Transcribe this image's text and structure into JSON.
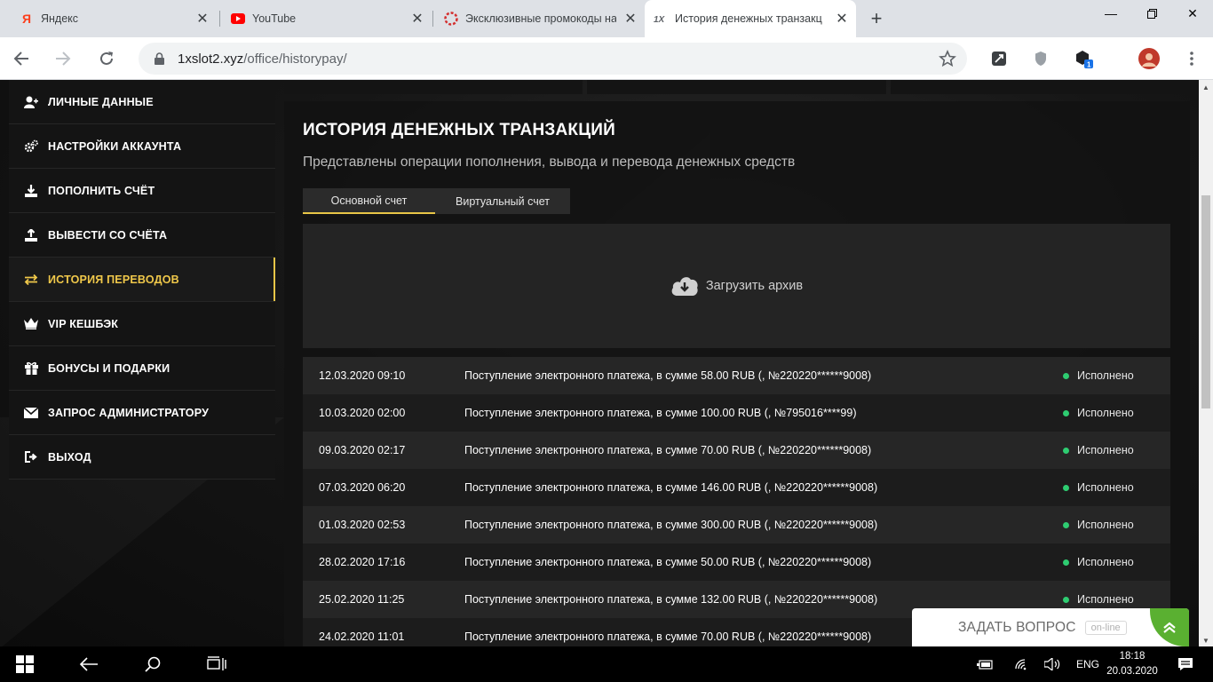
{
  "browser": {
    "tabs": [
      {
        "title": "Яндекс",
        "favicon": "yandex-icon",
        "active": false
      },
      {
        "title": "YouTube",
        "favicon": "youtube-icon",
        "active": false
      },
      {
        "title": "Эксклюзивные промокоды на",
        "favicon": "promo-icon",
        "active": false
      },
      {
        "title": "История денежных транзакц",
        "favicon": "1x-icon",
        "active": true
      }
    ],
    "url_host": "1xslot2.xyz",
    "url_path": "/office/historypay/",
    "extension_badge": "1"
  },
  "sidebar": {
    "items": [
      {
        "label": "ЛИЧНЫЕ ДАННЫЕ",
        "icon": "user-icon",
        "active": false
      },
      {
        "label": "НАСТРОЙКИ АККАУНТА",
        "icon": "gears-icon",
        "active": false
      },
      {
        "label": "ПОПОЛНИТЬ СЧЁТ",
        "icon": "download-icon",
        "active": false
      },
      {
        "label": "ВЫВЕСТИ СО СЧЁТА",
        "icon": "upload-icon",
        "active": false
      },
      {
        "label": "ИСТОРИЯ ПЕРЕВОДОВ",
        "icon": "transfer-arrows-icon",
        "active": true
      },
      {
        "label": "VIP КЕШБЭК",
        "icon": "crown-icon",
        "active": false
      },
      {
        "label": "БОНУСЫ И ПОДАРКИ",
        "icon": "gift-icon",
        "active": false
      },
      {
        "label": "ЗАПРОС АДМИНИСТРАТОРУ",
        "icon": "envelope-icon",
        "active": false
      },
      {
        "label": "ВЫХОД",
        "icon": "exit-icon",
        "active": false
      }
    ]
  },
  "main": {
    "title": "ИСТОРИЯ ДЕНЕЖНЫХ ТРАНЗАКЦИЙ",
    "subtitle": "Представлены операции пополнения, вывода и перевода денежных средств",
    "tabs": [
      {
        "label": "Основной счет",
        "active": true
      },
      {
        "label": "Виртуальный счет",
        "active": false
      }
    ],
    "archive_label": "Загрузить архив",
    "transactions": [
      {
        "date": "12.03.2020 09:10",
        "description": "Поступление электронного платежа, в сумме 58.00 RUB (, №220220******9008)",
        "status": "Исполнено"
      },
      {
        "date": "10.03.2020 02:00",
        "description": "Поступление электронного платежа, в сумме 100.00 RUB (, №795016****99)",
        "status": "Исполнено"
      },
      {
        "date": "09.03.2020 02:17",
        "description": "Поступление электронного платежа, в сумме 70.00 RUB (, №220220******9008)",
        "status": "Исполнено"
      },
      {
        "date": "07.03.2020 06:20",
        "description": "Поступление электронного платежа, в сумме 146.00 RUB (, №220220******9008)",
        "status": "Исполнено"
      },
      {
        "date": "01.03.2020 02:53",
        "description": "Поступление электронного платежа, в сумме 300.00 RUB (, №220220******9008)",
        "status": "Исполнено"
      },
      {
        "date": "28.02.2020 17:16",
        "description": "Поступление электронного платежа, в сумме 50.00 RUB (, №220220******9008)",
        "status": "Исполнено"
      },
      {
        "date": "25.02.2020 11:25",
        "description": "Поступление электронного платежа, в сумме 132.00 RUB (, №220220******9008)",
        "status": "Исполнено"
      },
      {
        "date": "24.02.2020 11:01",
        "description": "Поступление электронного платежа, в сумме 70.00 RUB (, №220220******9008)",
        "status": ""
      }
    ],
    "status_color": "#2ecc71",
    "accent_color": "#e8c547"
  },
  "chat_widget": {
    "label": "ЗАДАТЬ ВОПРОС",
    "online_label": "on-line"
  },
  "taskbar": {
    "language": "ENG",
    "time": "18:18",
    "date": "20.03.2020"
  }
}
